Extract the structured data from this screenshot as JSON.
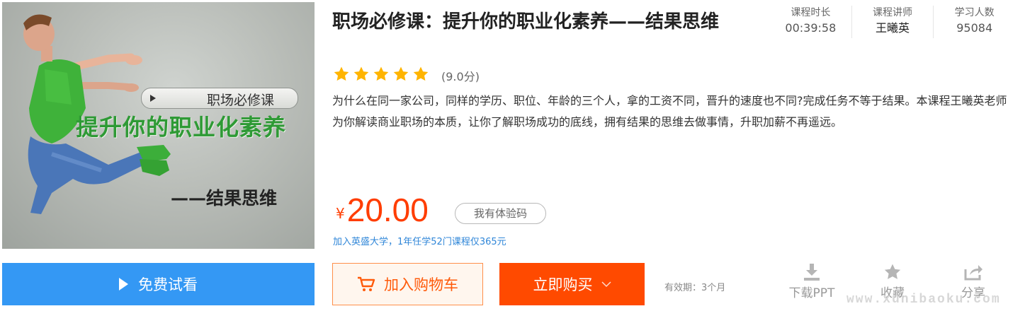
{
  "cover": {
    "badge": "职场必修课",
    "title": "提升你的职业化素养",
    "subtitle": "——结果思维"
  },
  "course": {
    "title": "职场必修课：提升你的职业化素养——结果思维",
    "rating": 5,
    "score": "(9.0分)",
    "description": "为什么在同一家公司，同样的学历、职位、年龄的三个人，拿的工资不同，晋升的速度也不同?完成任务不等于结果。本课程王曦英老师为你解读商业职场的本质，让你了解职场成功的底线，拥有结果的思维去做事情，升职加薪不再遥远。"
  },
  "stats": [
    {
      "label": "课程时长",
      "value": "00:39:58"
    },
    {
      "label": "课程讲师",
      "value": "王曦英"
    },
    {
      "label": "学习人数",
      "value": "95084"
    }
  ],
  "price": {
    "currency": "¥",
    "amount": "20.00"
  },
  "code_button": "我有体验码",
  "promo": "加入英盛大学，1年任学52门课程仅365元",
  "buttons": {
    "trial": "免费试看",
    "cart": "加入购物车",
    "buy": "立即购买"
  },
  "validity": "有效期：3个月",
  "tools": [
    {
      "label": "下载PPT",
      "icon": "download-icon"
    },
    {
      "label": "收藏",
      "icon": "star-icon"
    },
    {
      "label": "分享",
      "icon": "share-icon"
    }
  ],
  "watermark": "www.xunibaoku.com",
  "colors": {
    "accent_orange": "#ff4a00",
    "price": "#ff3d00",
    "trial_blue": "#3498f4",
    "star": "#ffb400",
    "cover_green": "#2e9a35"
  }
}
